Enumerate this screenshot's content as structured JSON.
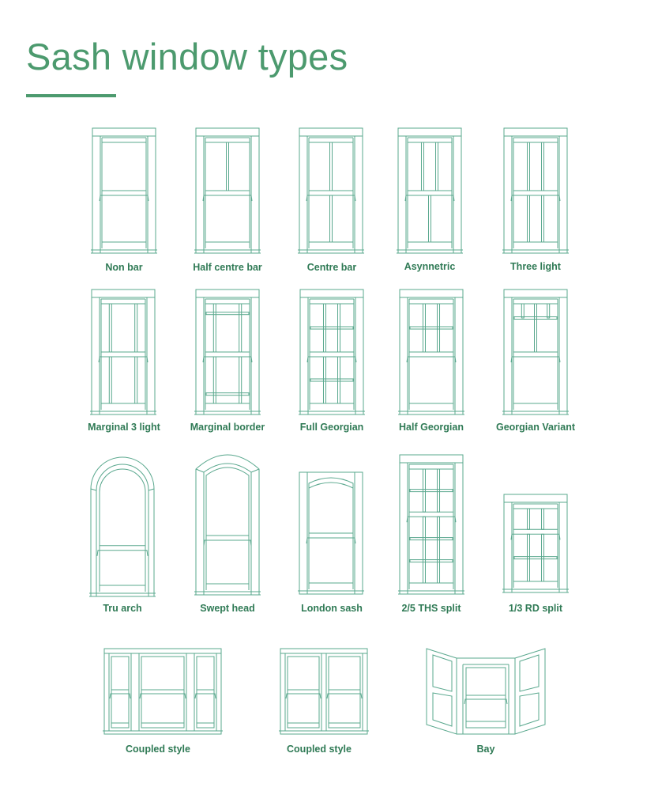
{
  "header": {
    "title": "Sash window types"
  },
  "colors": {
    "title": "#4c9a6e",
    "line": "#5aa88e",
    "label": "#2f7a55"
  },
  "windows": [
    {
      "id": "non-bar",
      "label": "Non bar",
      "style": "standard",
      "top": {
        "v": [],
        "h": []
      },
      "bottom": {
        "v": [],
        "h": []
      }
    },
    {
      "id": "half-centre-bar",
      "label": "Half centre bar",
      "style": "standard",
      "top": {
        "v": [
          0.5
        ],
        "h": []
      },
      "bottom": {
        "v": [],
        "h": []
      }
    },
    {
      "id": "centre-bar",
      "label": "Centre bar",
      "style": "standard",
      "top": {
        "v": [
          0.5
        ],
        "h": []
      },
      "bottom": {
        "v": [
          0.5
        ],
        "h": []
      }
    },
    {
      "id": "asynnetric",
      "label": "Asynnetric",
      "style": "standard",
      "top": {
        "v": [
          0.333,
          0.667
        ],
        "h": []
      },
      "bottom": {
        "v": [
          0.5
        ],
        "h": []
      }
    },
    {
      "id": "three-light",
      "label": "Three light",
      "style": "standard",
      "top": {
        "v": [
          0.333,
          0.667
        ],
        "h": []
      },
      "bottom": {
        "v": [
          0.333,
          0.667
        ],
        "h": []
      }
    },
    {
      "id": "marginal-3-light",
      "label": "Marginal 3 light",
      "style": "standard",
      "top": {
        "v": [
          0.2,
          0.8
        ],
        "h": []
      },
      "bottom": {
        "v": [
          0.2,
          0.8
        ],
        "h": []
      }
    },
    {
      "id": "marginal-border",
      "label": "Marginal border",
      "style": "standard",
      "top": {
        "v": [
          0.2,
          0.8
        ],
        "h": [
          0.2
        ]
      },
      "bottom": {
        "v": [
          0.2,
          0.8
        ],
        "h": [
          0.8
        ]
      }
    },
    {
      "id": "full-georgian",
      "label": "Full Georgian",
      "style": "standard",
      "top": {
        "v": [
          0.333,
          0.667
        ],
        "h": [
          0.5
        ]
      },
      "bottom": {
        "v": [
          0.333,
          0.667
        ],
        "h": [
          0.5
        ]
      }
    },
    {
      "id": "half-georgian",
      "label": "Half Georgian",
      "style": "standard",
      "top": {
        "v": [
          0.333,
          0.667
        ],
        "h": [
          0.5
        ]
      },
      "bottom": {
        "v": [],
        "h": []
      }
    },
    {
      "id": "georgian-variant",
      "label": "Georgian Variant",
      "style": "variant",
      "top": {
        "v": [
          0.5
        ],
        "h": []
      },
      "bottom": {
        "v": [],
        "h": []
      }
    },
    {
      "id": "tru-arch",
      "label": "Tru arch",
      "style": "arch",
      "top": {
        "v": [],
        "h": []
      },
      "bottom": {
        "v": [],
        "h": []
      }
    },
    {
      "id": "swept-head",
      "label": "Swept head",
      "style": "swept",
      "top": {
        "v": [],
        "h": []
      },
      "bottom": {
        "v": [],
        "h": []
      }
    },
    {
      "id": "london-sash",
      "label": "London sash",
      "style": "london",
      "top": {
        "v": [],
        "h": []
      },
      "bottom": {
        "v": [],
        "h": []
      }
    },
    {
      "id": "2-5-ths-split",
      "label": "2/5 THS split",
      "style": "standard",
      "split": 0.4,
      "top": {
        "v": [
          0.333,
          0.667
        ],
        "h": [
          0.5
        ]
      },
      "bottom": {
        "v": [
          0.333,
          0.667
        ],
        "h": [
          0.333,
          0.667
        ]
      }
    },
    {
      "id": "1-3-rd-split",
      "label": "1/3 RD split",
      "style": "standard",
      "split": 0.333,
      "top": {
        "v": [
          0.333,
          0.667
        ],
        "h": []
      },
      "bottom": {
        "v": [
          0.333,
          0.667
        ],
        "h": [
          0.5
        ]
      }
    },
    {
      "id": "coupled-style-3",
      "label": "Coupled style",
      "style": "coupled3",
      "top": {
        "v": [],
        "h": []
      },
      "bottom": {
        "v": [],
        "h": []
      }
    },
    {
      "id": "coupled-style-2",
      "label": "Coupled style",
      "style": "coupled2",
      "top": {
        "v": [],
        "h": []
      },
      "bottom": {
        "v": [],
        "h": []
      }
    },
    {
      "id": "bay",
      "label": "Bay",
      "style": "bay",
      "top": {
        "v": [],
        "h": []
      },
      "bottom": {
        "v": [],
        "h": []
      }
    }
  ]
}
